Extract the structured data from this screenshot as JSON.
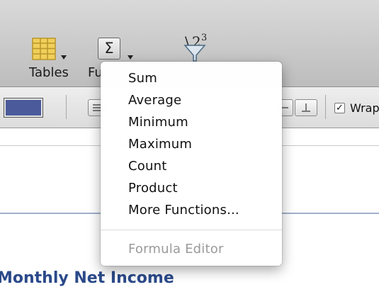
{
  "toolbar": {
    "tables_label": "Tables",
    "functions_label": "Fu",
    "tables_icon": "table-grid-icon",
    "functions_icon": "sigma-icon",
    "sort_filter_icon": "sort-filter-icon",
    "sigma_glyph": "Σ"
  },
  "format_bar": {
    "wrap_label": "Wrap",
    "wrap_checked": "✓",
    "fill_color": "#4a5a9b"
  },
  "menu": {
    "items": [
      "Sum",
      "Average",
      "Minimum",
      "Maximum",
      "Count",
      "Product",
      "More Functions..."
    ],
    "formula_editor_label": "Formula Editor"
  },
  "sheet": {
    "title": "Monthly Net Income"
  },
  "colors": {
    "sheet_title": "#2b4a8a",
    "table_icon": "#e7c24a"
  }
}
